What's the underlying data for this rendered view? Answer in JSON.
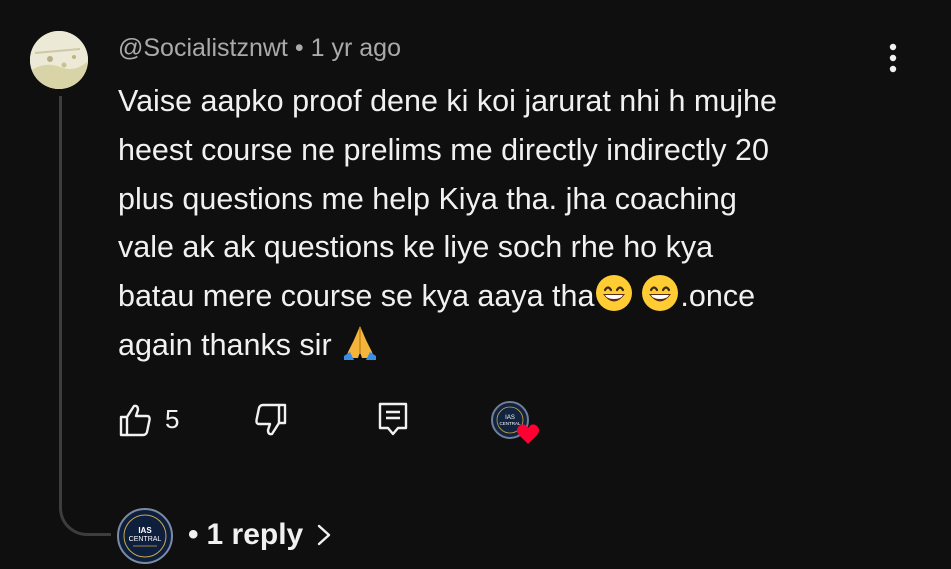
{
  "comment": {
    "author": "@Socialistznwt",
    "separator": "•",
    "time": "1 yr ago",
    "lines": [
      "Vaise aapko proof dene ki koi jarurat nhi h mujhe",
      "heest course ne prelims me directly indirectly 20",
      "plus questions me help Kiya tha. jha coaching",
      "vale ak ak questions ke liye soch rhe ho kya"
    ],
    "line5_text": "batau mere course se kya aaya tha",
    "line5_suffix": ".once",
    "line6_text": "again thanks sir ",
    "emojis": [
      "grinning-face",
      "grinning-face",
      "folded-hands"
    ]
  },
  "actions": {
    "like_count": "5"
  },
  "creator_badge": {
    "channel_text": "IAS CENTRAL",
    "heart_color": "#ff0033"
  },
  "replies": {
    "bullet": "•",
    "label": "1 reply"
  },
  "colors": {
    "background": "#0f0f0f",
    "text": "#f1f1f1",
    "meta": "#aaaaaa",
    "heart": "#ff0033"
  }
}
